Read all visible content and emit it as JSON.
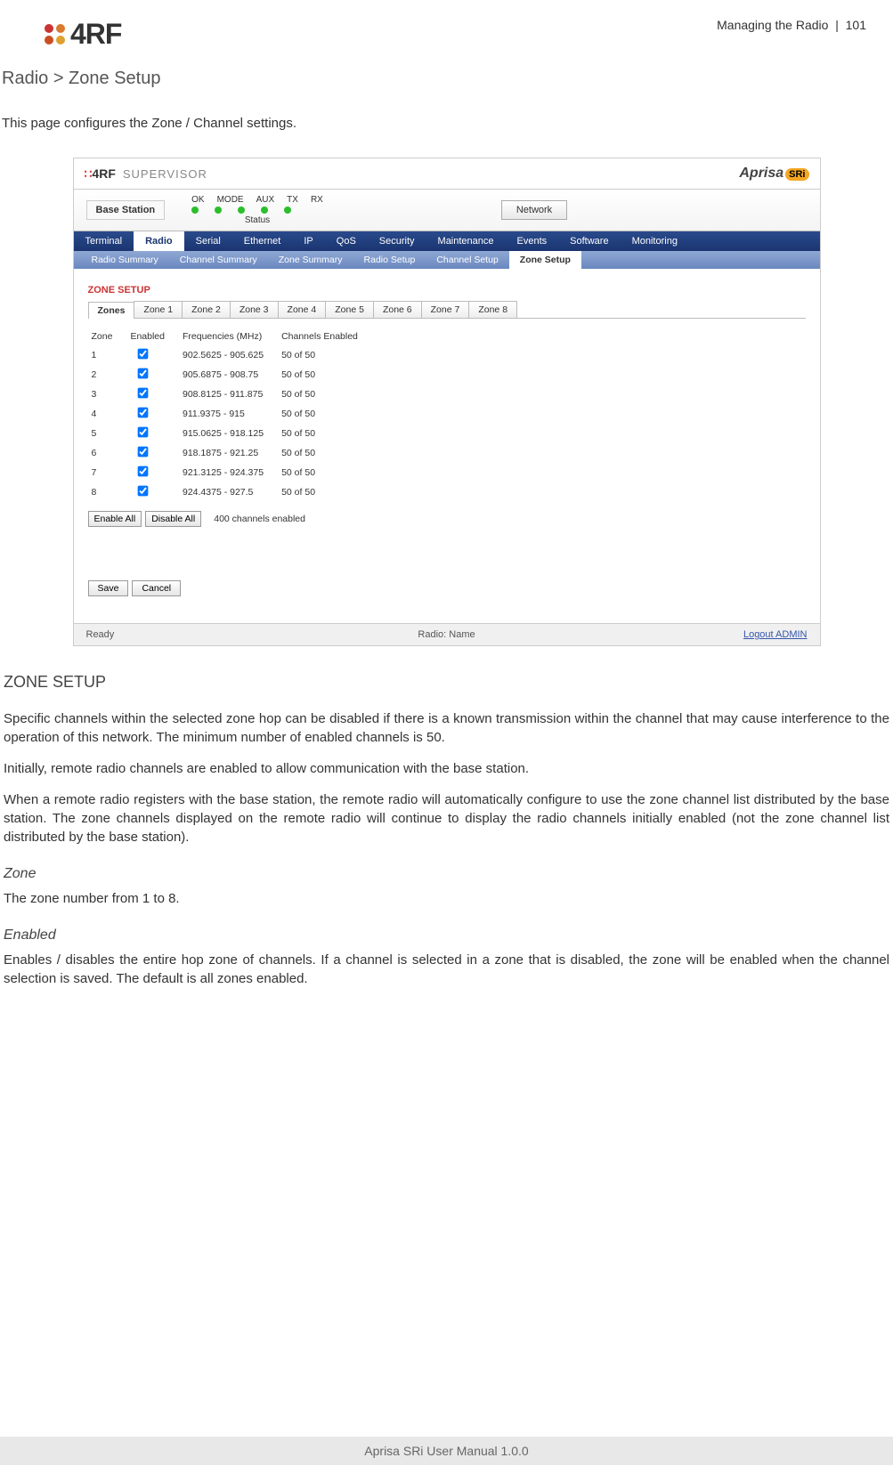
{
  "header": {
    "section": "Managing the Radio",
    "pageNum": "101",
    "logoText": "4RF"
  },
  "doc": {
    "sectionTitle": "Radio > Zone Setup",
    "intro": "This page configures the Zone / Channel settings.",
    "h2": "ZONE SETUP",
    "p1": "Specific channels within the selected zone hop can be disabled if there is a known transmission within the channel that may cause interference to the operation of this network. The minimum number of enabled channels is 50.",
    "p2": "Initially, remote radio channels are enabled to allow communication with the base station.",
    "p3": "When a remote radio registers with the base station, the remote radio will automatically configure to use the zone channel list distributed by the base station. The zone channels displayed on the remote radio will continue to display the radio channels initially enabled (not the zone channel list distributed by the base station).",
    "sub1Title": "Zone",
    "sub1Text": "The zone number from 1 to 8.",
    "sub2Title": "Enabled",
    "sub2Text": "Enables / disables the entire hop zone of channels. If a channel is selected in a zone that is disabled, the zone will be enabled when the channel selection is saved. The default is all zones enabled."
  },
  "shot": {
    "brand": "4RF",
    "supervisor": "SUPERVISOR",
    "aprisa": "Aprisa",
    "sri": "SRi",
    "baseStation": "Base Station",
    "leds": [
      "OK",
      "MODE",
      "AUX",
      "TX",
      "RX"
    ],
    "statusLabel": "Status",
    "network": "Network",
    "mainNav": [
      "Terminal",
      "Radio",
      "Serial",
      "Ethernet",
      "IP",
      "QoS",
      "Security",
      "Maintenance",
      "Events",
      "Software",
      "Monitoring"
    ],
    "mainNavActive": "Radio",
    "subNav": [
      "Radio Summary",
      "Channel Summary",
      "Zone Summary",
      "Radio Setup",
      "Channel Setup",
      "Zone Setup"
    ],
    "subNavActive": "Zone Setup",
    "panelTitle": "ZONE SETUP",
    "tabs": [
      "Zones",
      "Zone 1",
      "Zone 2",
      "Zone 3",
      "Zone 4",
      "Zone 5",
      "Zone 6",
      "Zone 7",
      "Zone 8"
    ],
    "tabsActive": "Zones",
    "tableHeaders": [
      "Zone",
      "Enabled",
      "Frequencies (MHz)",
      "Channels Enabled"
    ],
    "rows": [
      {
        "zone": "1",
        "freq": "902.5625 - 905.625",
        "ch": "50 of 50"
      },
      {
        "zone": "2",
        "freq": "905.6875 - 908.75",
        "ch": "50 of 50"
      },
      {
        "zone": "3",
        "freq": "908.8125 - 911.875",
        "ch": "50 of 50"
      },
      {
        "zone": "4",
        "freq": "911.9375 - 915",
        "ch": "50 of 50"
      },
      {
        "zone": "5",
        "freq": "915.0625 - 918.125",
        "ch": "50 of 50"
      },
      {
        "zone": "6",
        "freq": "918.1875 - 921.25",
        "ch": "50 of 50"
      },
      {
        "zone": "7",
        "freq": "921.3125 - 924.375",
        "ch": "50 of 50"
      },
      {
        "zone": "8",
        "freq": "924.4375 - 927.5",
        "ch": "50 of 50"
      }
    ],
    "enableAll": "Enable All",
    "disableAll": "Disable All",
    "channelsEnabledText": "400 channels enabled",
    "save": "Save",
    "cancel": "Cancel",
    "footerLeft": "Ready",
    "footerCenter": "Radio: Name",
    "footerRight": "Logout ADMIN"
  },
  "footer": "Aprisa SRi User Manual 1.0.0"
}
